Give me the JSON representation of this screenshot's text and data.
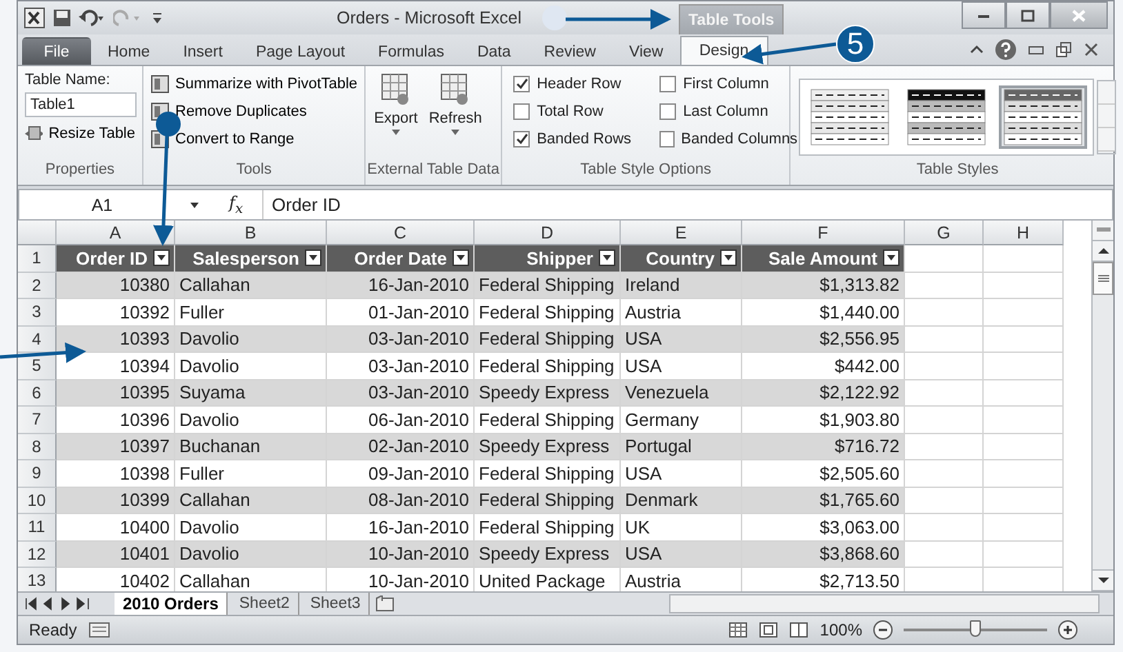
{
  "window": {
    "title": "Orders - Microsoft Excel",
    "context_group": "Table Tools"
  },
  "ribbon_tabs": [
    {
      "label": "File",
      "kind": "file",
      "selected": false
    },
    {
      "label": "Home",
      "kind": "tab",
      "selected": false
    },
    {
      "label": "Insert",
      "kind": "tab",
      "selected": false
    },
    {
      "label": "Page Layout",
      "kind": "tab",
      "selected": false
    },
    {
      "label": "Formulas",
      "kind": "tab",
      "selected": false
    },
    {
      "label": "Data",
      "kind": "tab",
      "selected": false
    },
    {
      "label": "Review",
      "kind": "tab",
      "selected": false
    },
    {
      "label": "View",
      "kind": "tab",
      "selected": false
    },
    {
      "label": "Design",
      "kind": "context",
      "selected": true
    }
  ],
  "ribbon": {
    "properties": {
      "group": "Properties",
      "table_name_label": "Table Name:",
      "table_name": "Table1",
      "resize": "Resize Table"
    },
    "tools": {
      "group": "Tools",
      "items": [
        "Summarize with PivotTable",
        "Remove Duplicates",
        "Convert to Range"
      ]
    },
    "external": {
      "group": "External Table Data",
      "items": [
        "Export",
        "Refresh"
      ]
    },
    "style_options": {
      "group": "Table Style Options",
      "options": [
        {
          "label": "Header Row",
          "checked": true
        },
        {
          "label": "Total Row",
          "checked": false
        },
        {
          "label": "Banded Rows",
          "checked": true
        },
        {
          "label": "First Column",
          "checked": false
        },
        {
          "label": "Last Column",
          "checked": false
        },
        {
          "label": "Banded Columns",
          "checked": false
        }
      ]
    },
    "table_styles": {
      "group": "Table Styles",
      "styles": [
        {
          "selected": false,
          "kind": "light"
        },
        {
          "selected": false,
          "kind": "dark"
        },
        {
          "selected": true,
          "kind": "medium"
        }
      ]
    }
  },
  "formula_bar": {
    "name_box": "A1",
    "fx": "f$_{x}$",
    "value": "Order ID"
  },
  "columns": [
    {
      "letter": "A",
      "header": "Order ID",
      "kind": "number"
    },
    {
      "letter": "B",
      "header": "Salesperson",
      "kind": "text"
    },
    {
      "letter": "C",
      "header": "Order Date",
      "kind": "number"
    },
    {
      "letter": "D",
      "header": "Shipper",
      "kind": "text"
    },
    {
      "letter": "E",
      "header": "Country",
      "kind": "text"
    },
    {
      "letter": "F",
      "header": "Sale Amount",
      "kind": "number"
    },
    {
      "letter": "G"
    },
    {
      "letter": "H"
    }
  ],
  "header_row_number": "1",
  "rows": [
    {
      "number": "2",
      "cells": [
        "10380",
        "Callahan",
        "16-Jan-2010",
        "Federal Shipping",
        "Ireland",
        "$1,313.82"
      ]
    },
    {
      "number": "3",
      "cells": [
        "10392",
        "Fuller",
        "01-Jan-2010",
        "Federal Shipping",
        "Austria",
        "$1,440.00"
      ]
    },
    {
      "number": "4",
      "cells": [
        "10393",
        "Davolio",
        "03-Jan-2010",
        "Federal Shipping",
        "USA",
        "$2,556.95"
      ]
    },
    {
      "number": "5",
      "cells": [
        "10394",
        "Davolio",
        "03-Jan-2010",
        "Federal Shipping",
        "USA",
        "$442.00"
      ]
    },
    {
      "number": "6",
      "cells": [
        "10395",
        "Suyama",
        "03-Jan-2010",
        "Speedy Express",
        "Venezuela",
        "$2,122.92"
      ]
    },
    {
      "number": "7",
      "cells": [
        "10396",
        "Davolio",
        "06-Jan-2010",
        "Federal Shipping",
        "Germany",
        "$1,903.80"
      ]
    },
    {
      "number": "8",
      "cells": [
        "10397",
        "Buchanan",
        "02-Jan-2010",
        "Speedy Express",
        "Portugal",
        "$716.72"
      ]
    },
    {
      "number": "9",
      "cells": [
        "10398",
        "Fuller",
        "09-Jan-2010",
        "Federal Shipping",
        "USA",
        "$2,505.60"
      ]
    },
    {
      "number": "10",
      "cells": [
        "10399",
        "Callahan",
        "08-Jan-2010",
        "Federal Shipping",
        "Denmark",
        "$1,765.60"
      ]
    },
    {
      "number": "11",
      "cells": [
        "10400",
        "Davolio",
        "16-Jan-2010",
        "Federal Shipping",
        "UK",
        "$3,063.00"
      ]
    },
    {
      "number": "12",
      "cells": [
        "10401",
        "Davolio",
        "10-Jan-2010",
        "Speedy Express",
        "USA",
        "$3,868.60"
      ]
    },
    {
      "number": "13",
      "cells": [
        "10402",
        "Callahan",
        "10-Jan-2010",
        "United Package",
        "Austria",
        "$2,713.50"
      ]
    }
  ],
  "sheet_tabs": [
    {
      "label": "2010 Orders",
      "selected": true
    },
    {
      "label": "Sheet2",
      "selected": false
    },
    {
      "label": "Sheet3",
      "selected": false
    }
  ],
  "status_bar": {
    "status": "Ready",
    "zoom": "100%",
    "zoom_slider": {
      "level": 0.5
    }
  },
  "callouts": [
    {
      "kind": "dot"
    },
    {
      "kind": "number",
      "label": "5"
    },
    {
      "kind": "dot"
    },
    {
      "kind": "plain"
    }
  ]
}
